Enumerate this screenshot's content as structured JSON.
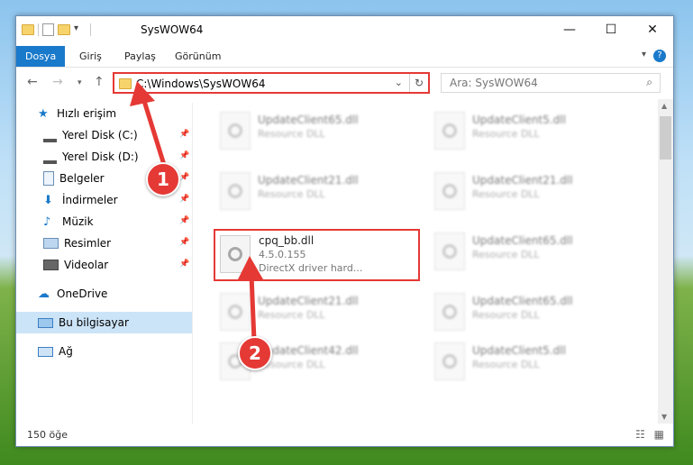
{
  "window": {
    "title": "SysWOW64"
  },
  "menu": {
    "file": "Dosya",
    "home": "Giriş",
    "share": "Paylaş",
    "view": "Görünüm",
    "help": "?"
  },
  "address": {
    "path": "C:\\Windows\\SysWOW64"
  },
  "search": {
    "placeholder": "Ara: SysWOW64"
  },
  "sidebar": {
    "quick_access": "Hızlı erişim",
    "items": [
      {
        "label": "Yerel Disk (C:)"
      },
      {
        "label": "Yerel Disk (D:)"
      },
      {
        "label": "Belgeler"
      },
      {
        "label": "İndirmeler"
      },
      {
        "label": "Müzik"
      },
      {
        "label": "Resimler"
      },
      {
        "label": "Videolar"
      }
    ],
    "onedrive": "OneDrive",
    "this_pc": "Bu bilgisayar",
    "network": "Ağ"
  },
  "files": {
    "left": [
      {
        "name": "UpdateClient65.dll",
        "desc": "Resource DLL"
      },
      {
        "name": "UpdateClient21.dll",
        "desc": "Resource DLL"
      },
      {
        "name": "UpdateClient21.dll",
        "desc": "Resource DLL"
      },
      {
        "name": "UpdateClient42.dll",
        "desc": "Resource DLL"
      }
    ],
    "right": [
      {
        "name": "UpdateClient5.dll",
        "desc": "Resource DLL"
      },
      {
        "name": "UpdateClient21.dll",
        "desc": "Resource DLL"
      },
      {
        "name": "UpdateClient65.dll",
        "desc": "Resource DLL"
      },
      {
        "name": "UpdateClient65.dll",
        "desc": "Resource DLL"
      },
      {
        "name": "UpdateClient5.dll",
        "desc": "Resource DLL"
      }
    ],
    "highlighted": {
      "name": "cpq_bb.dll",
      "version": "4.5.0.155",
      "desc": "DirectX driver hard..."
    }
  },
  "status": {
    "count": "150 öğe"
  },
  "badges": {
    "one": "1",
    "two": "2"
  },
  "colors": {
    "accent": "#1979ca",
    "highlight": "#e53935"
  }
}
